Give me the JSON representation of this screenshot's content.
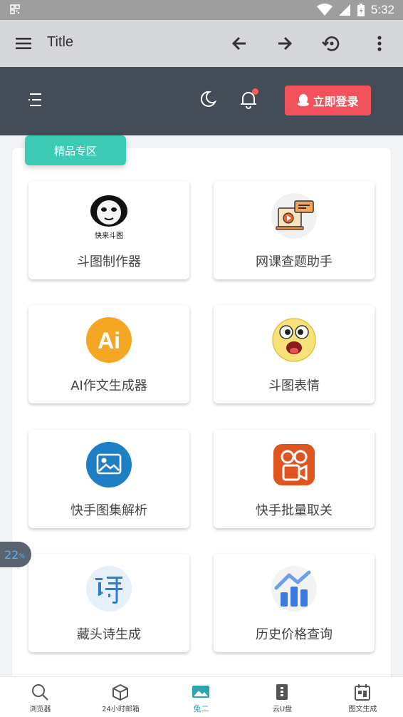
{
  "status_bar": {
    "time": "5:32"
  },
  "app_bar": {
    "title": "Title"
  },
  "header": {
    "login_label": "立即登录"
  },
  "section": {
    "badge": "精品专区",
    "tool_tile_1_caption": "快来斗图"
  },
  "tools": [
    {
      "label": "斗图制作器",
      "icon": "panda-meme-icon"
    },
    {
      "label": "网课查题助手",
      "icon": "online-class-icon"
    },
    {
      "label": "AI作文生成器",
      "icon": "ai-icon"
    },
    {
      "label": "斗图表情",
      "icon": "emoji-face-icon"
    },
    {
      "label": "快手图集解析",
      "icon": "image-icon"
    },
    {
      "label": "快手批量取关",
      "icon": "kuaishou-icon"
    },
    {
      "label": "藏头诗生成",
      "icon": "poem-icon"
    },
    {
      "label": "历史价格查询",
      "icon": "price-chart-icon"
    }
  ],
  "floating_badge": {
    "value": "22",
    "unit": "%"
  },
  "bottom_nav": [
    {
      "label": "浏览器",
      "icon": "search-icon"
    },
    {
      "label": "24小时邮箱",
      "icon": "box-icon"
    },
    {
      "label": "兔二",
      "icon": "image-icon",
      "active": true
    },
    {
      "label": "云U盘",
      "icon": "usb-icon"
    },
    {
      "label": "图文生成",
      "icon": "calendar-icon"
    }
  ],
  "colors": {
    "header": "#444c57",
    "login": "#f2535a",
    "badge": "#3ecbb6",
    "active": "#2aa7ae"
  }
}
